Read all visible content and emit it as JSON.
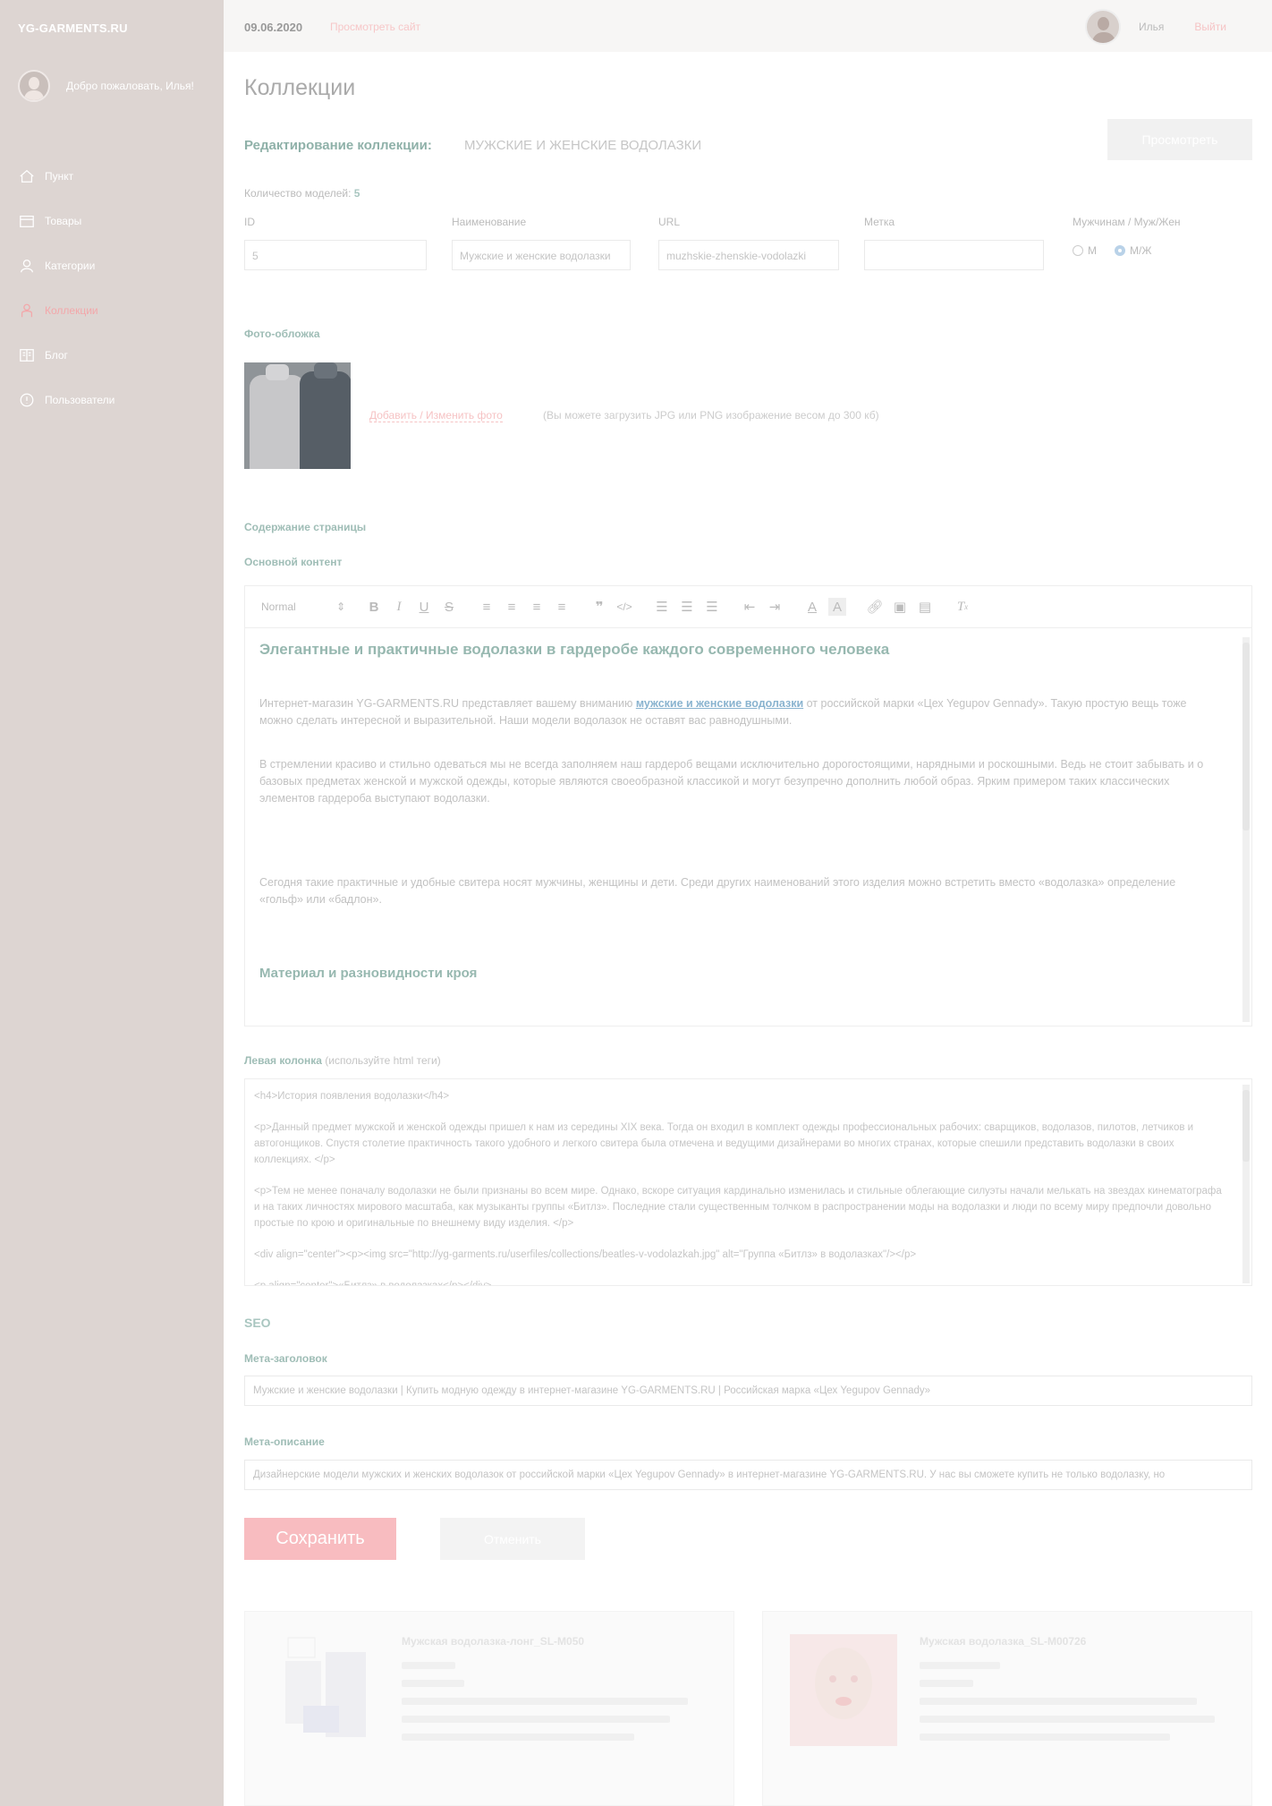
{
  "sidebar": {
    "brand": "YG-GARMENTS.RU",
    "welcome": "Добро пожаловать, Илья!",
    "items": [
      {
        "label": "Пункт",
        "icon": "home-icon"
      },
      {
        "label": "Товары",
        "icon": "box-icon"
      },
      {
        "label": "Категории",
        "icon": "category-icon"
      },
      {
        "label": "Коллекции",
        "icon": "collection-icon",
        "active": true
      },
      {
        "label": "Блог",
        "icon": "blog-icon"
      },
      {
        "label": "Пользователи",
        "icon": "users-icon"
      }
    ]
  },
  "topbar": {
    "date": "09.06.2020",
    "view_site": "Просмотреть сайт",
    "username": "Илья",
    "logout": "Выйти"
  },
  "page": {
    "title": "Коллекции",
    "edit_label": "Редактирование коллекции:",
    "edit_name": "МУЖСКИЕ И ЖЕНСКИЕ ВОДОЛАЗКИ",
    "right_button": "Просмотреть",
    "model_count_label": "Количество моделей:",
    "model_count_value": "5"
  },
  "fields": {
    "id": {
      "label": "ID",
      "value": "5"
    },
    "name": {
      "label": "Наименование",
      "value": "Мужские и женские водолазки"
    },
    "url": {
      "label": "URL",
      "value": "muzhskie-zhenskie-vodolazki"
    },
    "tag": {
      "label": "Метка",
      "value": ""
    },
    "gender": {
      "label": "Мужчинам / Муж/Жен",
      "options": [
        "М",
        "М/Ж"
      ],
      "selected": "М/Ж"
    }
  },
  "cover": {
    "heading": "Фото-обложка",
    "link": "Добавить / Изменить фото",
    "hint": "(Вы можете загрузить JPG или PNG изображение весом до 300 кб)"
  },
  "content": {
    "heading": "Содержание страницы",
    "main_label": "Основной контент",
    "format_select": "Normal",
    "h2_1": "Элегантные и практичные водолазки в гардеробе каждого современного человека",
    "p1_before": "Интернет-магазин YG-GARMENTS.RU представляет вашему вниманию ",
    "p1_link": "мужские и женские водолазки",
    "p1_after": " от российской марки «Цех Yegupov Gennady». Такую простую вещь тоже можно сделать интересной и выразительной. Наши модели водолазок не оставят вас равнодушными.",
    "p2": "В стремлении красиво и стильно одеваться мы не всегда заполняем наш гардероб вещами исключительно дорогостоящими, нарядными и роскошными. Ведь не стоит забывать и о базовых предметах женской и мужской одежды, которые являются своеобразной классикой и могут безупречно дополнить любой образ. Ярким примером таких классических элементов гардероба выступают водолазки.",
    "p3": " Сегодня такие практичные и удобные свитера носят мужчины, женщины и дети. Среди других наименований этого изделия можно встретить вместо «водолазка» определение «гольф» или «бадлон».",
    "h2_2": "Материал и разновидности кроя"
  },
  "left_column": {
    "label": "Левая колонка",
    "hint": " (используйте html теги)",
    "lines": [
      "<h4>История появления водолазки</h4>",
      "<p>Данный предмет мужской и женской одежды пришел к нам из середины XIX века. Тогда он входил в комплект одежды профессиональных рабочих: сварщиков, водолазов, пилотов, летчиков и автогонщиков. Спустя столетие практичность такого удобного и легкого свитера была отмечена и ведущими дизайнерами во многих странах, которые спешили представить водолазки в своих коллекциях. </p>",
      "<p>Тем не менее поначалу водолазки не были признаны во всем мире. Однако, вскоре ситуация кардинально изменилась и стильные облегающие силуэты начали мелькать на звездах кинематографа и на таких личностях мирового масштаба, как музыканты группы «Битлз». Последние стали существенным толчком в распространении моды на водолазки и люди по всему миру предпочли довольно простые по крою и оригинальные по внешнему виду изделия. </p>",
      "<div align=\"center\"><p><img src=\"http://yg-garments.ru/userfiles/collections/beatles-v-vodolazkah.jpg\" alt=\"Группа «Битлз» в водолазках\"/></p>",
      "<p align=\"center\">«Битлз» в водолазках</p></div>"
    ]
  },
  "seo": {
    "title": "SEO",
    "meta_title_label": "Мета-заголовок",
    "meta_title_value": "Мужские и женские водолазки | Купить модную одежду в интернет-магазине YG-GARMENTS.RU | Российская марка «Цех Yegupov Gennady»",
    "meta_desc_label": "Мета-описание",
    "meta_desc_value": "Дизайнерские модели мужских и женских водолазок от российской марки «Цех Yegupov Gennady» в интернет-магазине YG-GARMENTS.RU. У нас вы сможете купить не только водолазку, но"
  },
  "actions": {
    "save": "Сохранить",
    "cancel": "Отменить"
  },
  "cards": [
    {
      "title": "Мужская водолазка-лонг_SL-M050"
    },
    {
      "title": "Мужская водолазка_SL-M00726"
    }
  ],
  "colors": {
    "sidebar_bg": "#ddd5d2",
    "accent_pink": "#f8bcc0",
    "accent_teal": "#9fbdb6",
    "link_blue": "#89b3cf"
  }
}
